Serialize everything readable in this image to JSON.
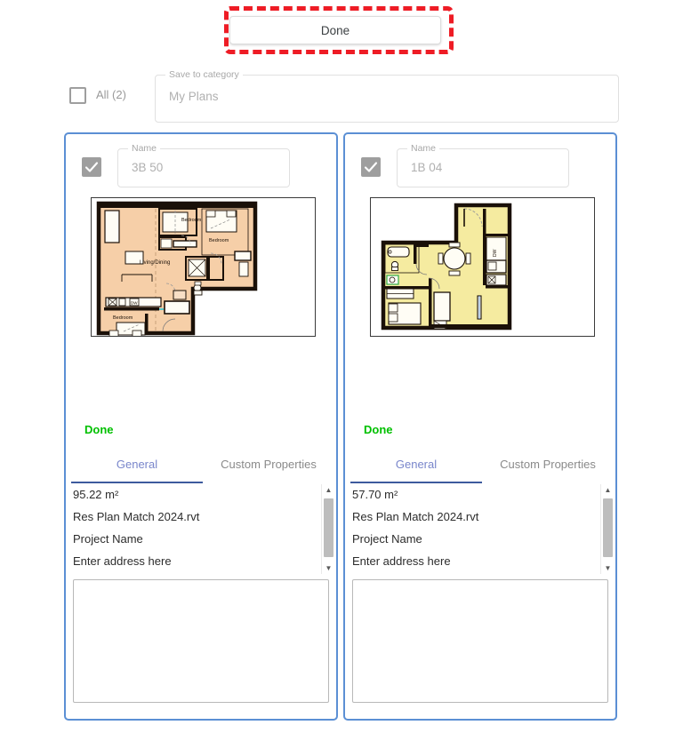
{
  "toolbar": {
    "done_label": "Done",
    "highlight_color": "#ee1c25"
  },
  "category_row": {
    "all_checkbox_label": "All (2)",
    "all_checked": false,
    "field_legend": "Save to category",
    "field_value": "My Plans"
  },
  "tabs_common": {
    "general_label": "General",
    "custom_properties_label": "Custom Properties",
    "active_tab": "General",
    "active_color": "#7986cb",
    "underline_color": "#3d5a9e"
  },
  "status_common": {
    "label": "Done",
    "color": "#00c000"
  },
  "name_legend": "Name",
  "cards": [
    {
      "checked": true,
      "name_value": "3B 50",
      "status": "Done",
      "plan": {
        "fill": "#f6cfa8",
        "wall": "#1a1008",
        "outline": "#e8a04a",
        "labels": [
          "Bedroom",
          "Bedroom",
          "Living/Dining",
          "Bedroom"
        ]
      },
      "properties": [
        "95.22 m²",
        "Res Plan Match 2024.rvt",
        "Project Name",
        "Enter address here"
      ],
      "notes_value": ""
    },
    {
      "checked": true,
      "name_value": "1B 04",
      "status": "Done",
      "plan": {
        "fill": "#f5eba0",
        "wall": "#1a1008",
        "outline": "#e8a9a0",
        "labels": []
      },
      "properties": [
        "57.70 m²",
        "Res Plan Match 2024.rvt",
        "Project Name",
        "Enter address here"
      ],
      "notes_value": ""
    }
  ]
}
